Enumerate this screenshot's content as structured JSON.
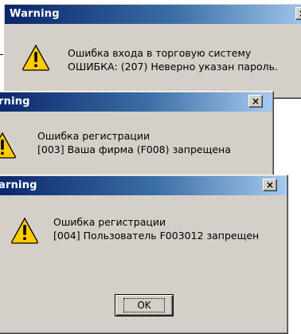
{
  "dialogs": [
    {
      "title": "Warning",
      "close": "×",
      "line1": "Ошибка входа в торговую систему",
      "line2": "ОШИБКА: (207) Неверно указан пароль."
    },
    {
      "title": "rning",
      "close": "×",
      "line1": "Ошибка регистрации",
      "line2": "[003] Ваша фирма (F008) запрещена"
    },
    {
      "title": "arning",
      "close": "×",
      "line1": "Ошибка регистрации",
      "line2": "[004] Пользователь F003012 запрещен",
      "ok_label": "OK"
    }
  ],
  "icons": {
    "warning": "warning-icon"
  },
  "colors": {
    "title_start": "#0a246a",
    "title_end": "#a6caf0",
    "face": "#d4d0c8",
    "warning_fill": "#ffcc00"
  }
}
